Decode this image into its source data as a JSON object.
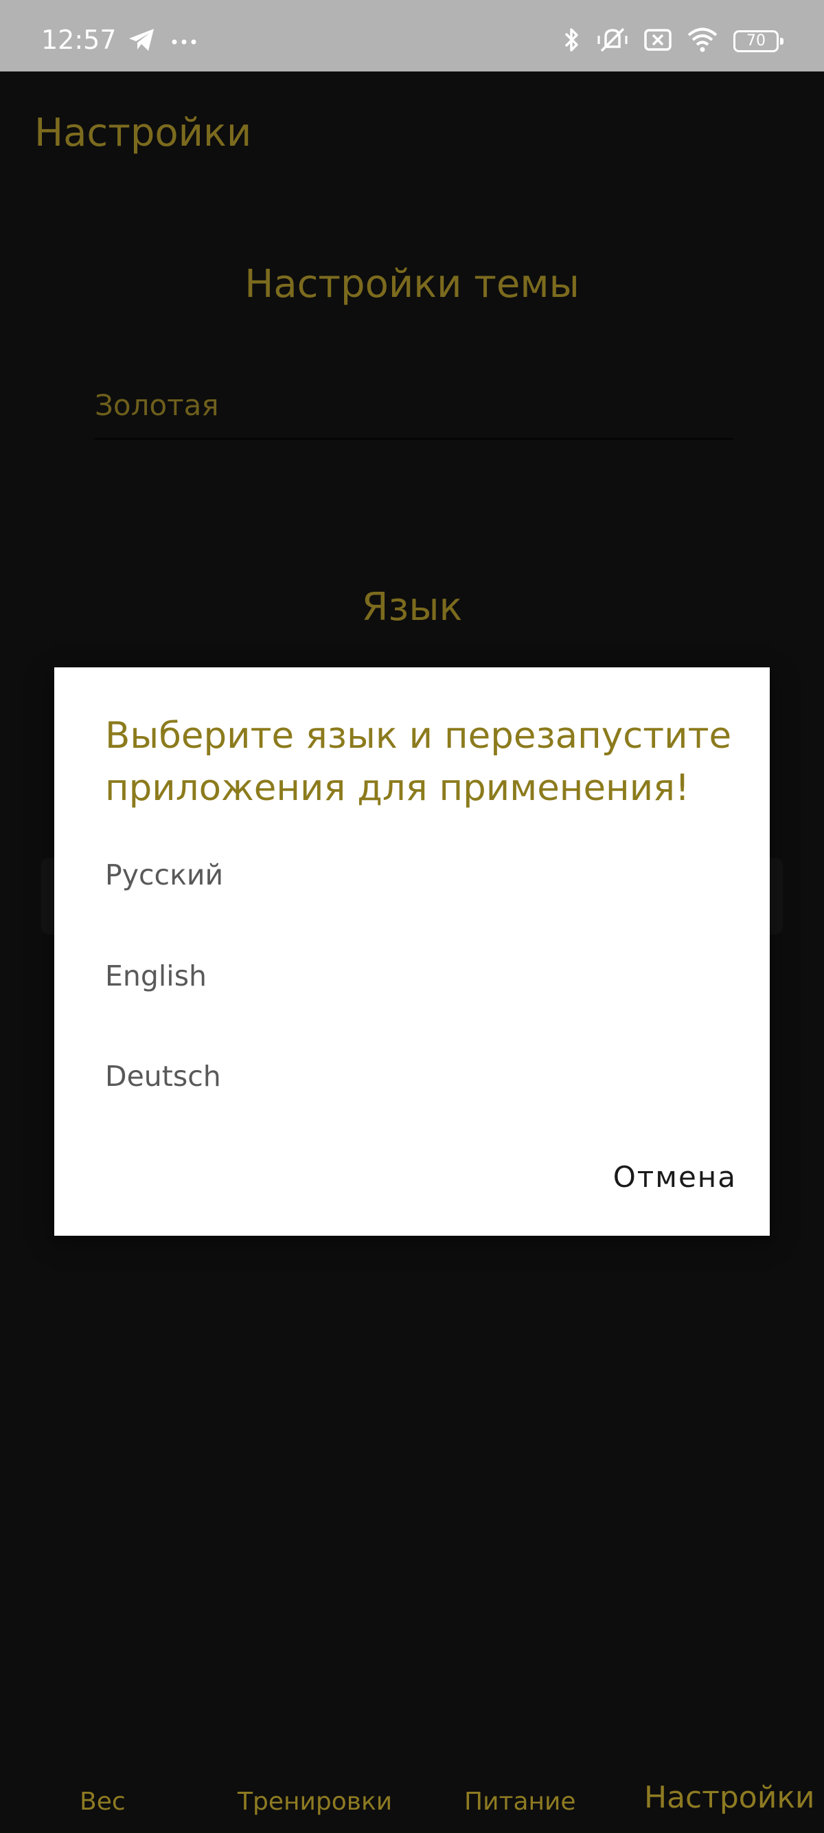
{
  "status_bar": {
    "time": "12:57",
    "left_icons": [
      "telegram-icon",
      "more-dots-icon"
    ],
    "right_icons": [
      "bluetooth-icon",
      "mute-vibrate-icon",
      "sim-off-icon",
      "wifi-icon"
    ],
    "battery": "70"
  },
  "header": {
    "title": "Настройки"
  },
  "settings": {
    "theme_heading": "Настройки темы",
    "theme_value": "Золотая",
    "language_heading": "Язык"
  },
  "dialog": {
    "title": "Выберите язык и перезапустите приложения для применения!",
    "options": [
      "Русский",
      "English",
      "Deutsch"
    ],
    "cancel_label": "Отмена"
  },
  "bottom_nav": {
    "items": [
      {
        "label": "Вес"
      },
      {
        "label": "Тренировки"
      },
      {
        "label": "Питание"
      },
      {
        "label": "Настройки"
      }
    ],
    "active_index": 3
  },
  "colors": {
    "background": "#0d0d0d",
    "accent_gold": "#8c7b1d",
    "dim_gold": "#7c6b1e",
    "status_bar": "#b3b3b3",
    "dialog_bg": "#ffffff"
  }
}
